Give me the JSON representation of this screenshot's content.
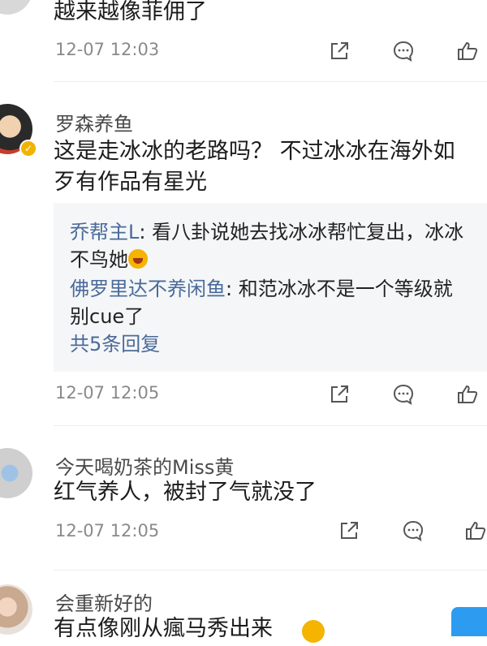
{
  "comments": [
    {
      "text_lines": [
        "越来越像菲佣了"
      ],
      "time": "12-07 12:03"
    },
    {
      "username": "罗森养鱼",
      "text_lines": [
        "这是走冰冰的老路吗？ 不过冰冰在海外如",
        "歹有作品有星光"
      ],
      "replies": [
        {
          "name": "乔帮主L",
          "lines": [
            ": 看八卦说她去找冰冰帮忙复出，冰冰",
            "不鸟她"
          ]
        },
        {
          "name": "佛罗里达不养闲鱼",
          "lines": [
            ": 和范冰冰不是一个等级就",
            "别cue了"
          ]
        }
      ],
      "more_replies": "共5条回复",
      "time": "12-07 12:05"
    },
    {
      "username": "今天喝奶茶的Miss黄",
      "text_lines": [
        "红气养人，被封了气就没了"
      ],
      "time": "12-07 12:05"
    },
    {
      "username": "会重新好的",
      "text_lines": [
        "有点像刚从瘋马秀出来"
      ]
    }
  ],
  "icons": {
    "share": "share-icon",
    "comment": "comment-icon",
    "like": "like-icon",
    "verified": "verified-badge-icon"
  },
  "colors": {
    "reply_name": "#4a6a99",
    "timestamp": "#8a8a8a",
    "verified": "#f0b400"
  }
}
